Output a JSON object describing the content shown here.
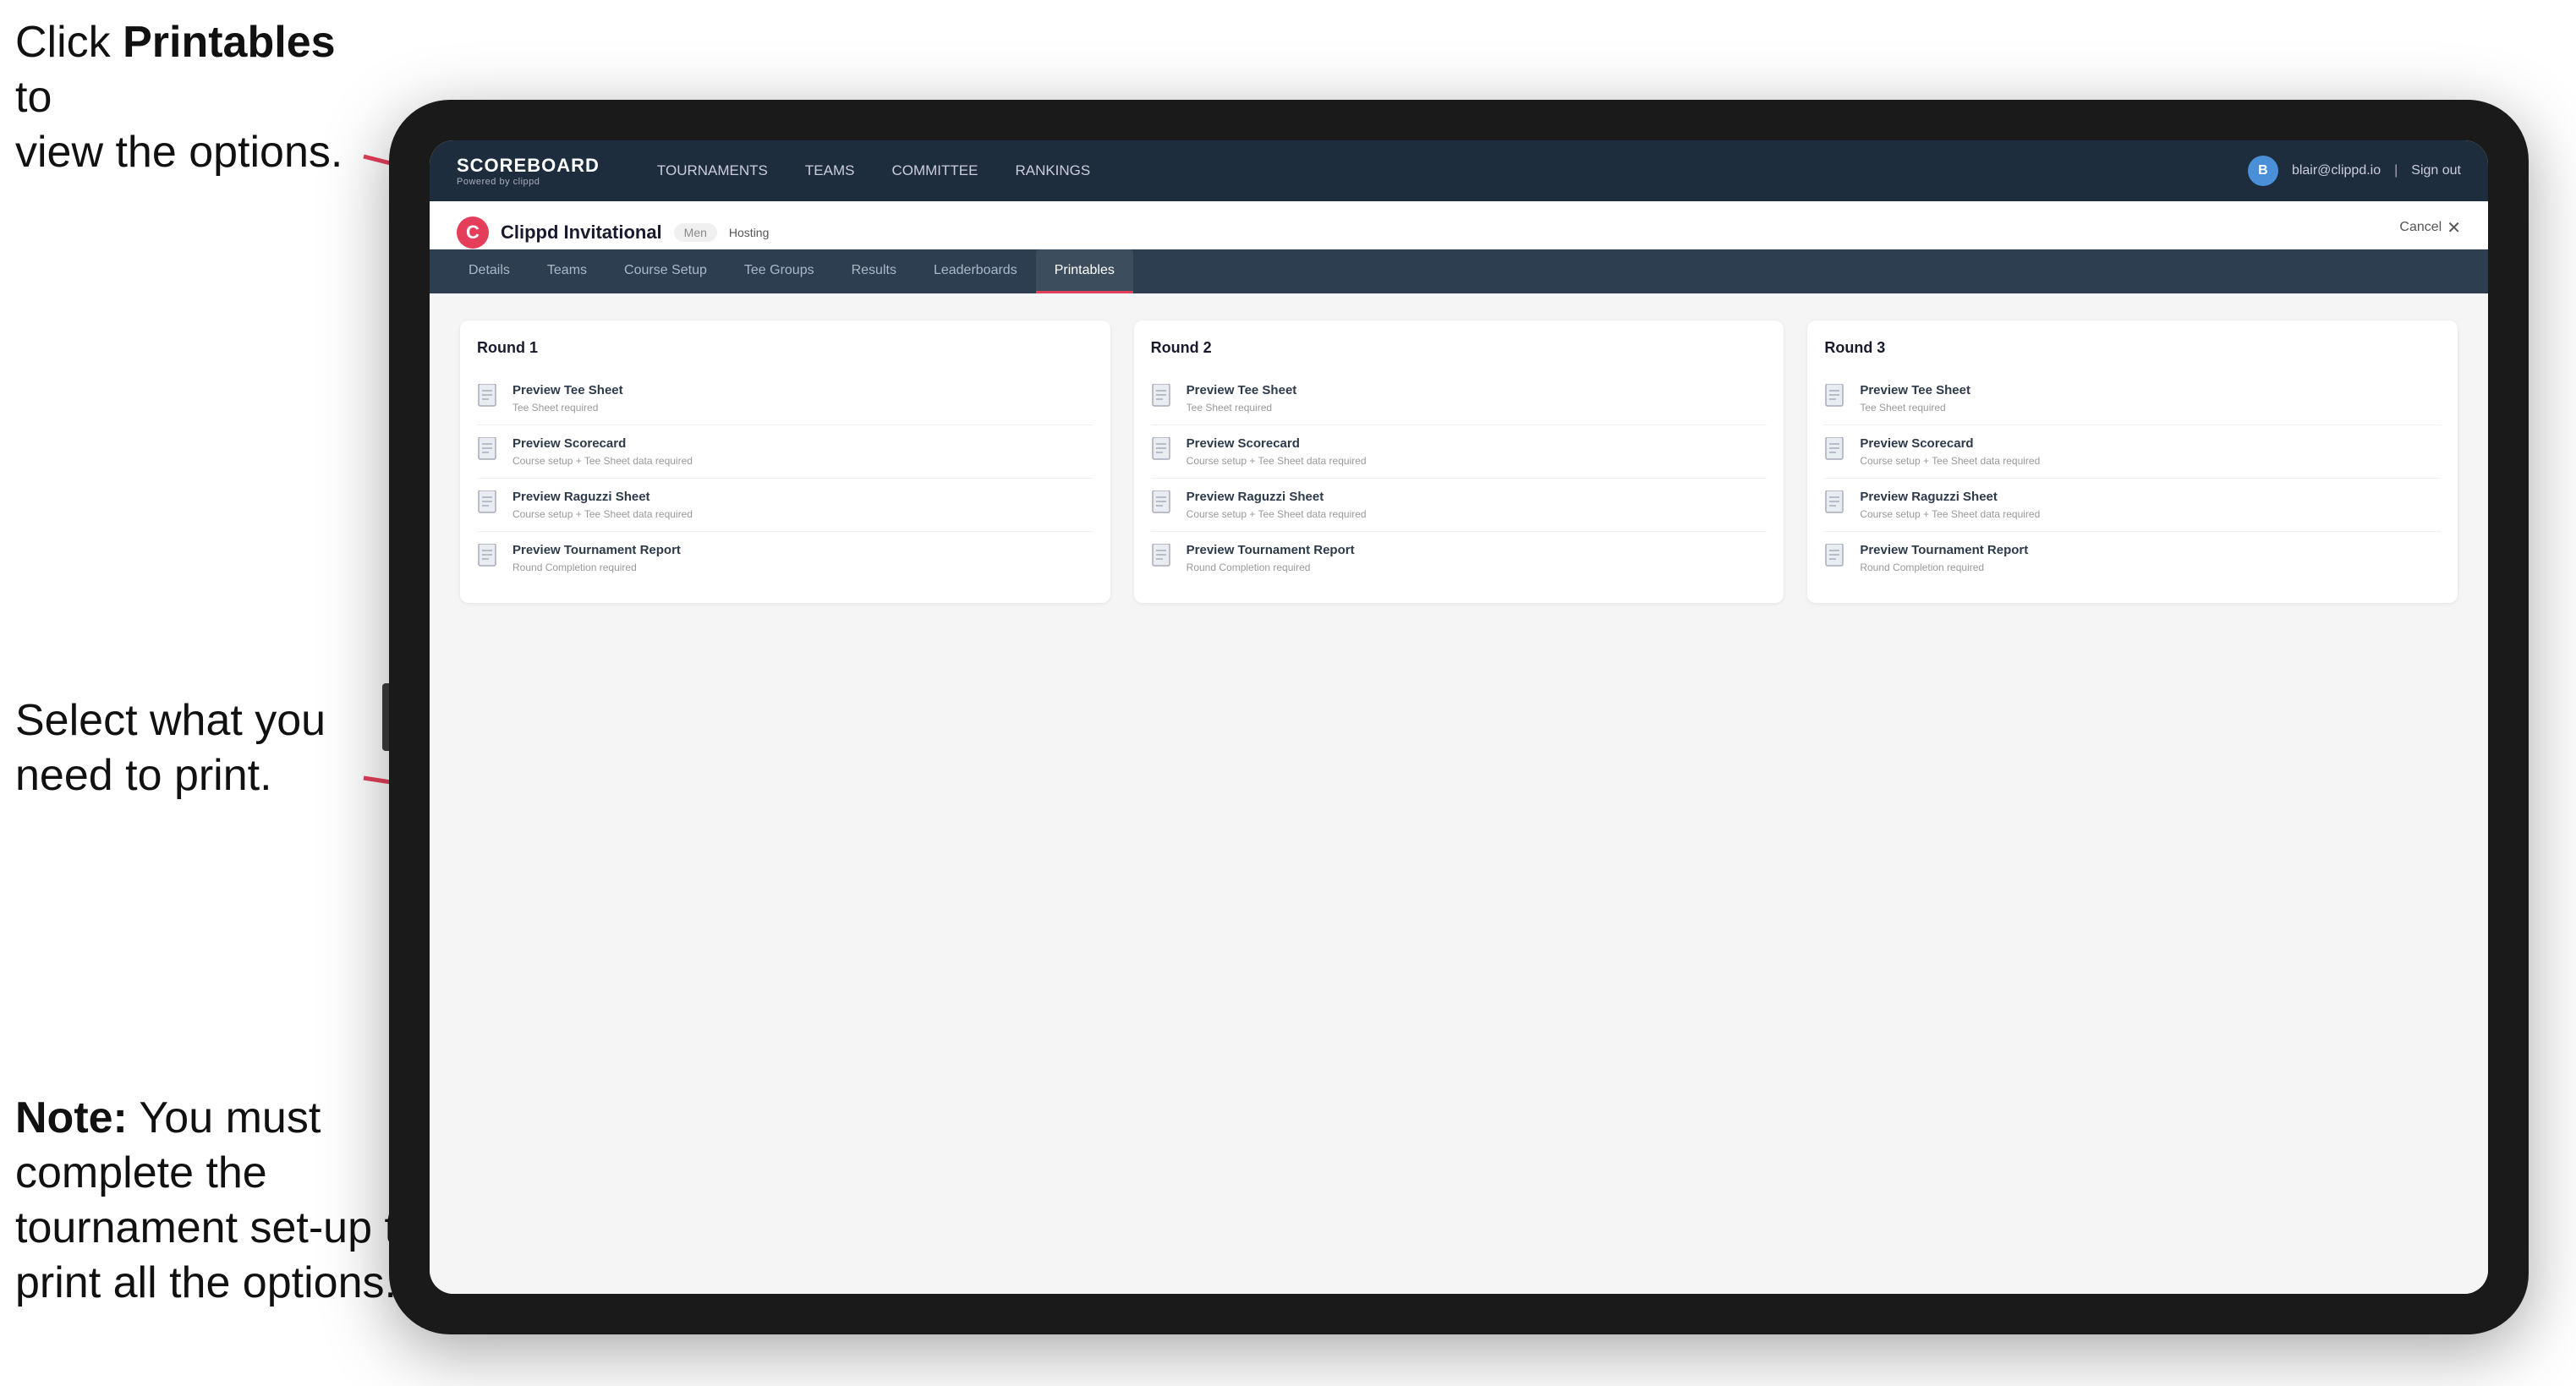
{
  "annotations": {
    "top_text_line1": "Click ",
    "top_text_bold": "Printables",
    "top_text_line2": " to",
    "top_text_line3": "view the options.",
    "mid_text": "Select what you need to print.",
    "bottom_note_bold": "Note:",
    "bottom_text": " You must complete the tournament set-up to print all the options."
  },
  "nav": {
    "logo_title": "SCOREBOARD",
    "logo_subtitle": "Powered by clippd",
    "items": [
      {
        "label": "TOURNAMENTS"
      },
      {
        "label": "TEAMS"
      },
      {
        "label": "COMMITTEE"
      },
      {
        "label": "RANKINGS"
      }
    ],
    "user_email": "blair@clippd.io",
    "sign_out": "Sign out"
  },
  "tournament": {
    "logo_letter": "C",
    "name": "Clippd Invitational",
    "badge_men": "Men",
    "hosting": "Hosting",
    "cancel": "Cancel"
  },
  "sub_tabs": [
    {
      "label": "Details",
      "active": false
    },
    {
      "label": "Teams",
      "active": false
    },
    {
      "label": "Course Setup",
      "active": false
    },
    {
      "label": "Tee Groups",
      "active": false
    },
    {
      "label": "Results",
      "active": false
    },
    {
      "label": "Leaderboards",
      "active": false
    },
    {
      "label": "Printables",
      "active": true
    }
  ],
  "rounds": [
    {
      "title": "Round 1",
      "items": [
        {
          "name": "Preview Tee Sheet",
          "req": "Tee Sheet required"
        },
        {
          "name": "Preview Scorecard",
          "req": "Course setup + Tee Sheet data required"
        },
        {
          "name": "Preview Raguzzi Sheet",
          "req": "Course setup + Tee Sheet data required"
        },
        {
          "name": "Preview Tournament Report",
          "req": "Round Completion required"
        }
      ]
    },
    {
      "title": "Round 2",
      "items": [
        {
          "name": "Preview Tee Sheet",
          "req": "Tee Sheet required"
        },
        {
          "name": "Preview Scorecard",
          "req": "Course setup + Tee Sheet data required"
        },
        {
          "name": "Preview Raguzzi Sheet",
          "req": "Course setup + Tee Sheet data required"
        },
        {
          "name": "Preview Tournament Report",
          "req": "Round Completion required"
        }
      ]
    },
    {
      "title": "Round 3",
      "items": [
        {
          "name": "Preview Tee Sheet",
          "req": "Tee Sheet required"
        },
        {
          "name": "Preview Scorecard",
          "req": "Course setup + Tee Sheet data required"
        },
        {
          "name": "Preview Raguzzi Sheet",
          "req": "Course setup + Tee Sheet data required"
        },
        {
          "name": "Preview Tournament Report",
          "req": "Round Completion required"
        }
      ]
    }
  ]
}
